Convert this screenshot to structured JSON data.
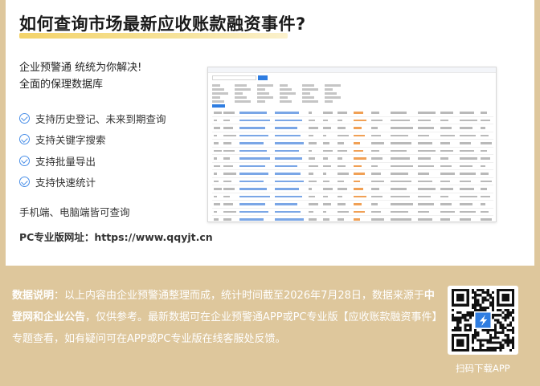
{
  "title": "如何查询市场最新应收账款融资事件?",
  "intro": [
    "企业预警通 统统为你解决!",
    "全面的保理数据库"
  ],
  "features": [
    "支持历史登记、未来到期查询",
    "支持关键字搜索",
    "支持批量导出",
    "支持快速统计"
  ],
  "devices": "手机端、电脑端皆可查询",
  "pc_url": "PC专业版网址：https://www.qqyjt.cn",
  "footer": {
    "label": "数据说明",
    "part1": "：以上内容由企业预警通整理而成，统计时间截至2026年7月28日，数据来源于",
    "source": "中登网和企业公告",
    "part2": "，仅供参考。最新数据可在企业预警通APP或PC专业版【应收账款融资事件】专题查看，如有疑问可在APP或PC专业版在线客服处反馈。"
  },
  "qr_label": "扫码下载APP",
  "colors": {
    "background": "#dec79c",
    "accent": "#4a8fe8",
    "highlight": "#f3d36a"
  }
}
